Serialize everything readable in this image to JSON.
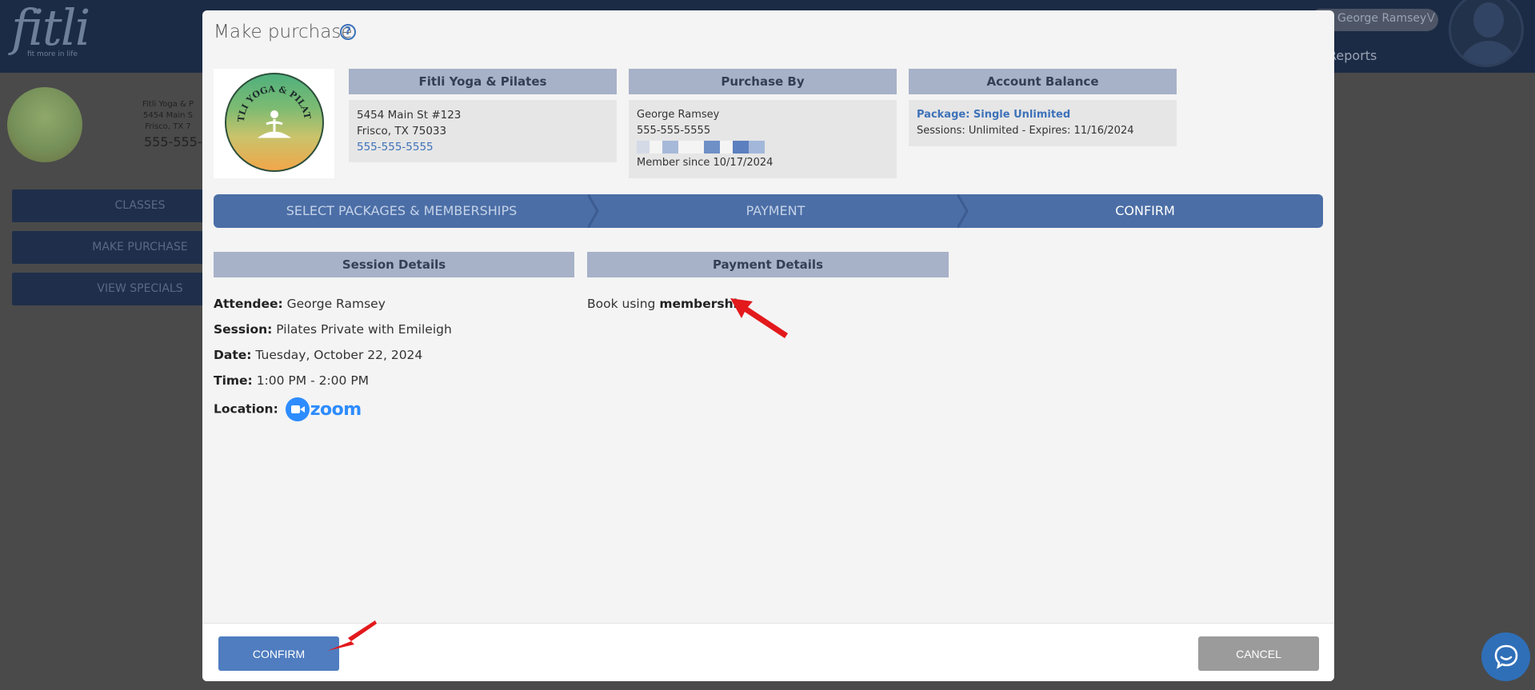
{
  "background": {
    "logo": "fitli",
    "logo_tagline": "fit more in life",
    "user_name": "George Ramsey",
    "reports_label": "Reports",
    "studio_name": "Fitli Yoga & P",
    "studio_address1": "5454 Main S",
    "studio_address2": "Frisco, TX 7",
    "studio_phone": "555-555-",
    "nav": [
      "CLASSES",
      "MAKE PURCHASE",
      "VIEW SPECIALS"
    ]
  },
  "modal": {
    "title": "Make purchase",
    "help_glyph": "?",
    "logo_text": "FITLI YOGA & PILATES",
    "studio": {
      "header": "Fitli Yoga & Pilates",
      "address1": "5454 Main St #123",
      "address2": "Frisco, TX 75033",
      "phone": "555-555-5555"
    },
    "purchase_by": {
      "header": "Purchase By",
      "name": "George Ramsey",
      "phone": "555-555-5555",
      "member_since": "Member since 10/17/2024",
      "swatch_colors": [
        "#d4dbe7",
        "#f4f4f4",
        "#a7b9d9",
        "#f4f4f4",
        "#f4f4f4",
        "#6f8fc7",
        "#f4f4f4",
        "#5c7fbf",
        "#a3b7da"
      ]
    },
    "account_balance": {
      "header": "Account Balance",
      "package": "Package: Single Unlimited",
      "sessions": "Sessions: Unlimited -  Expires: 11/16/2024"
    },
    "steps": [
      {
        "label": "SELECT PACKAGES & MEMBERSHIPS",
        "active": false
      },
      {
        "label": "PAYMENT",
        "active": false
      },
      {
        "label": "CONFIRM",
        "active": true
      }
    ],
    "session_details": {
      "header": "Session Details",
      "attendee_label": "Attendee:",
      "attendee": "George Ramsey",
      "session_label": "Session:",
      "session": "Pilates Private with Emileigh",
      "date_label": "Date:",
      "date": "Tuesday, October 22, 2024",
      "time_label": "Time:",
      "time": "1:00 PM - 2:00 PM",
      "location_label": "Location:",
      "location_logo": "zoom"
    },
    "payment_details": {
      "header": "Payment Details",
      "prefix": "Book using",
      "method": "membership"
    },
    "footer": {
      "confirm": "CONFIRM",
      "cancel": "CANCEL"
    }
  },
  "colors": {
    "accent": "#4f7dc0",
    "step_bar": "#4b6ea6",
    "section_header": "#a7b1c8",
    "link": "#3e72b9",
    "annotation_arrow": "#e3191c"
  }
}
